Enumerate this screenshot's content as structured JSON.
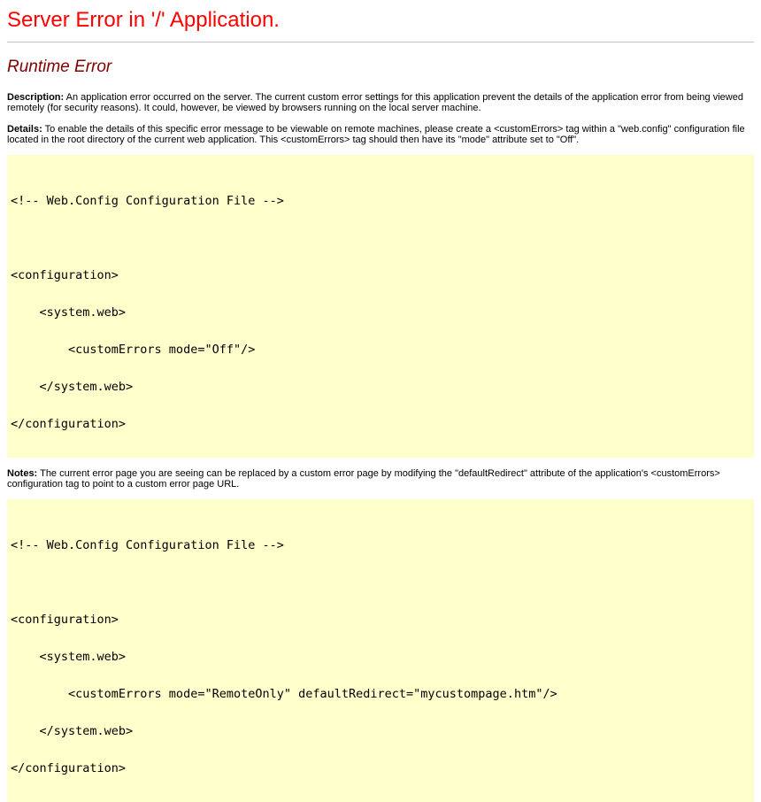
{
  "page": {
    "title": "Server Error in '/' Application.",
    "subtitle": "Runtime Error",
    "description_label": "Description:",
    "description_text": "An application error occurred on the server. The current custom error settings for this application prevent the details of the application error from being viewed remotely (for security reasons). It could, however, be viewed by browsers running on the local server machine.",
    "details_label": "Details:",
    "details_text": "To enable the details of this specific error message to be viewable on remote machines, please create a <customErrors> tag within a \"web.config\" configuration file located in the root directory of the current web application. This <customErrors> tag should then have its \"mode\" attribute set to \"Off\".",
    "notes_label": "Notes:",
    "notes_text": "The current error page you are seeing can be replaced by a custom error page by modifying the \"defaultRedirect\" attribute of the application's <customErrors> configuration tag to point to a custom error page URL."
  },
  "code_block_1": {
    "lines": [
      "<!-- Web.Config Configuration File -->",
      "",
      "<configuration>",
      "    <system.web>",
      "        <customErrors mode=\"Off\"/>",
      "    </system.web>",
      "</configuration>"
    ]
  },
  "code_block_2": {
    "lines": [
      "<!-- Web.Config Configuration File -->",
      "",
      "<configuration>",
      "    <system.web>",
      "        <customErrors mode=\"RemoteOnly\" defaultRedirect=\"mycustompage.htm\"/>",
      "    </system.web>",
      "</configuration>"
    ]
  },
  "colors": {
    "title": "#ff0000",
    "subtitle": "#800000",
    "code_background": "#ffffcc",
    "rule": "#c0c0c0"
  }
}
